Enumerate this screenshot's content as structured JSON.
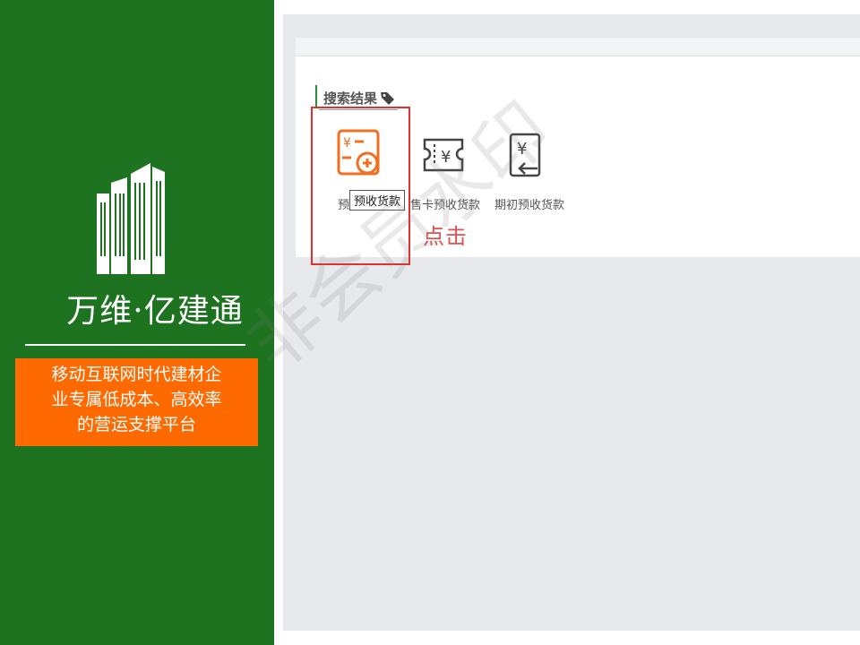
{
  "brand": {
    "name": "万维·亿建通",
    "tagline_lines": [
      "移动互联网时代建材企",
      "业专属低成本、高效率",
      "的营运支撑平台"
    ],
    "logo_icon": "buildings-icon",
    "panel_color": "#1e7320",
    "tagline_color": "#ff6a00"
  },
  "results": {
    "title": "搜索结果",
    "title_icon": "tag-icon",
    "items": [
      {
        "label": "预收货款",
        "icon": "advance-payment-icon",
        "icon_color": "#f07020"
      },
      {
        "label": "售卡预收货款",
        "icon": "card-payment-icon",
        "icon_color": "#444444"
      },
      {
        "label": "期初预收货款",
        "icon": "initial-payment-icon",
        "icon_color": "#444444"
      }
    ],
    "tooltip": "预收货款"
  },
  "annotation": {
    "click_hint": "点击",
    "highlight_color": "#e03030"
  },
  "watermark": "非会员水印"
}
